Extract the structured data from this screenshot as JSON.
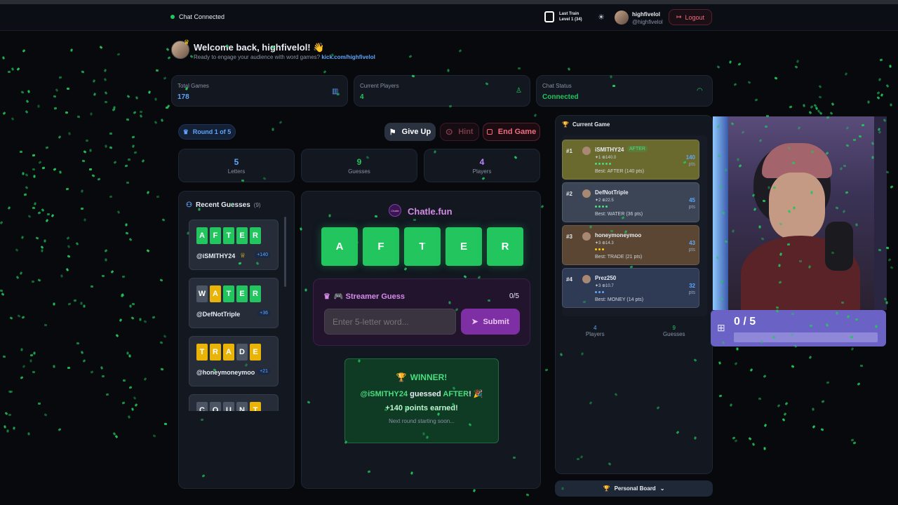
{
  "nav": {
    "chat_status": "Chat Connected",
    "last_train_title": "Last Train",
    "last_train_level": "Level 1 (34)",
    "username": "highfivelol",
    "handle": "@highfivelol",
    "logout_label": "Logout"
  },
  "welcome": {
    "title": "Welcome back, highfivelol! 👋",
    "subtitle": "Ready to engage your audience with word games?",
    "link": "kick.com/highfivelol"
  },
  "stats": [
    {
      "label": "Total Games",
      "value": "178",
      "icon": "bar-chart-icon"
    },
    {
      "label": "Current Players",
      "value": "4",
      "icon": "user-icon"
    },
    {
      "label": "Chat Status",
      "value": "Connected",
      "icon": "wifi-icon"
    }
  ],
  "controls": {
    "round": "Round 1 of 5",
    "give_up": "Give Up",
    "hint": "Hint",
    "end_game": "End Game"
  },
  "mini_stats": [
    {
      "value": "5",
      "label": "Letters"
    },
    {
      "value": "9",
      "label": "Guesses"
    },
    {
      "value": "4",
      "label": "Players"
    }
  ],
  "recent": {
    "title": "Recent Guesses",
    "count": "(9)",
    "items": [
      {
        "letters": [
          "A",
          "F",
          "T",
          "E",
          "R"
        ],
        "colors": [
          "green",
          "green",
          "green",
          "green",
          "green"
        ],
        "user": "@iSMITHY24",
        "points": "+140",
        "trophy": true
      },
      {
        "letters": [
          "W",
          "A",
          "T",
          "E",
          "R"
        ],
        "colors": [
          "grey",
          "yellow",
          "green",
          "green",
          "green"
        ],
        "user": "@DefNotTriple",
        "points": "+36",
        "trophy": false
      },
      {
        "letters": [
          "T",
          "R",
          "A",
          "D",
          "E"
        ],
        "colors": [
          "yellow",
          "yellow",
          "yellow",
          "grey",
          "yellow"
        ],
        "user": "@honeymoneymoo",
        "points": "+21",
        "trophy": false
      },
      {
        "letters": [
          "C",
          "O",
          "U",
          "N",
          "T"
        ],
        "colors": [
          "grey",
          "grey",
          "grey",
          "grey",
          "yellow"
        ],
        "user": "",
        "points": "",
        "trophy": false
      }
    ]
  },
  "board": {
    "brand": "Chatle.fun",
    "logo_text": "Chatle",
    "word": [
      "A",
      "F",
      "T",
      "E",
      "R"
    ]
  },
  "streamer": {
    "title": "🎮 Streamer Guess",
    "count": "0/5",
    "placeholder": "Enter 5-letter word...",
    "submit": "Submit"
  },
  "winner": {
    "title": "WINNER!",
    "user": "@iSMITHY24",
    "guessed": "guessed",
    "word": "AFTER",
    "exclaim": "! 🎉",
    "points": "+140 points earned!",
    "next": "Next round starting soon..."
  },
  "current_game": {
    "title": "Current Game",
    "players": [
      {
        "rank": "#1",
        "name": "iSMITHY24",
        "tag": "AFTER",
        "stats": "✦1 ⊕140.0",
        "best": "Best: AFTER (140 pts)",
        "pts": "140",
        "unit": "pts",
        "accent": "#6b6a2e"
      },
      {
        "rank": "#2",
        "name": "DefNotTriple",
        "tag": "",
        "stats": "✦2 ⊕22.5",
        "best": "Best: WATER (36 pts)",
        "pts": "45",
        "unit": "pts",
        "accent": "#3b4556"
      },
      {
        "rank": "#3",
        "name": "honeymoneymoo",
        "tag": "",
        "stats": "✦3 ⊕14.3",
        "best": "Best: TRADE (21 pts)",
        "pts": "43",
        "unit": "pts",
        "accent": "#5a4632"
      },
      {
        "rank": "#4",
        "name": "Prez250",
        "tag": "",
        "stats": "✦3 ⊕10.7",
        "best": "Best: MONEY (14 pts)",
        "pts": "32",
        "unit": "pts",
        "accent": "#2f3a55"
      }
    ],
    "footer": [
      {
        "value": "4",
        "label": "Players"
      },
      {
        "value": "9",
        "label": "Guesses"
      }
    ],
    "personal_board": "Personal Board"
  },
  "overlay": {
    "progress_text": "0 / 5",
    "progress_fraction": 0
  }
}
